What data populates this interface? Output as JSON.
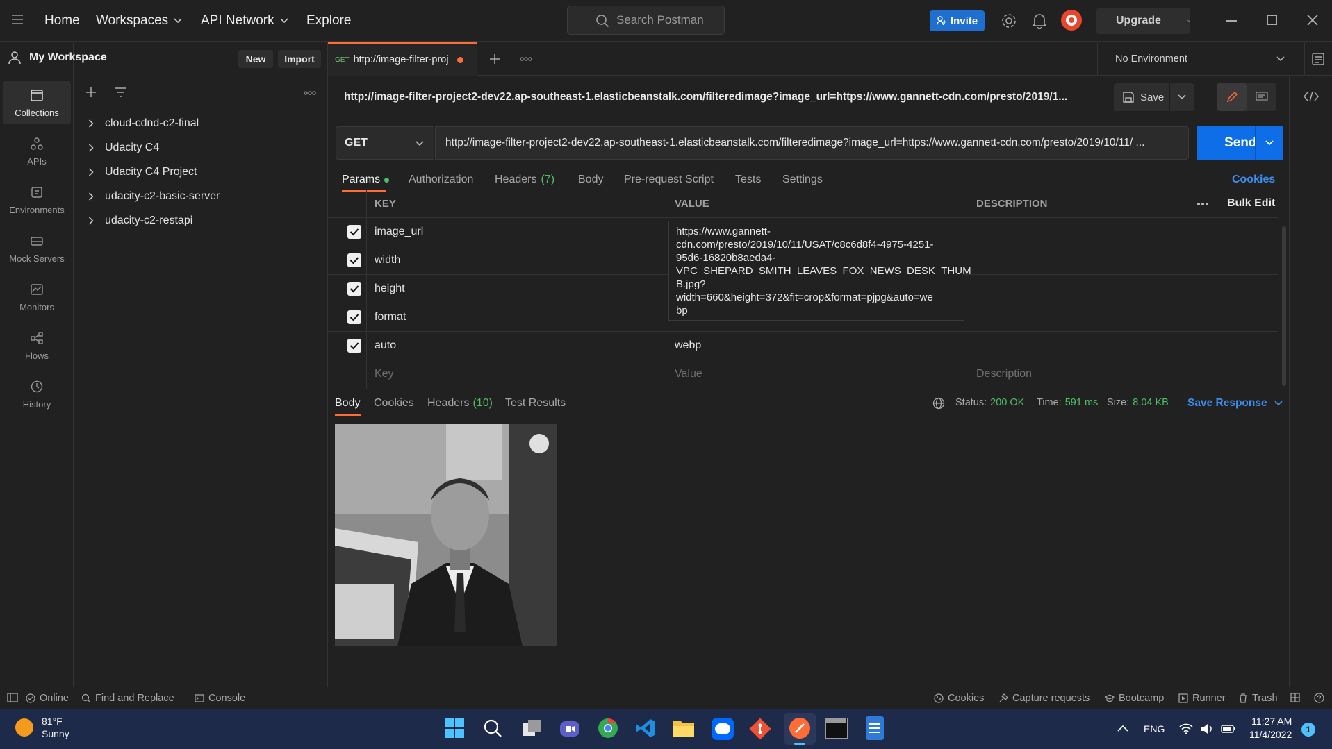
{
  "topbar": {
    "nav": [
      "Home",
      "Workspaces",
      "API Network",
      "Explore"
    ],
    "search_placeholder": "Search Postman",
    "invite_label": "Invite",
    "upgrade_label": "Upgrade"
  },
  "workspace": {
    "name": "My Workspace",
    "new_label": "New",
    "import_label": "Import"
  },
  "rail": {
    "items": [
      {
        "label": "Collections",
        "icon": "collections-icon"
      },
      {
        "label": "APIs",
        "icon": "apis-icon"
      },
      {
        "label": "Environments",
        "icon": "environments-icon"
      },
      {
        "label": "Mock Servers",
        "icon": "mock-servers-icon"
      },
      {
        "label": "Monitors",
        "icon": "monitors-icon"
      },
      {
        "label": "Flows",
        "icon": "flows-icon"
      },
      {
        "label": "History",
        "icon": "history-icon"
      }
    ]
  },
  "collections": [
    "cloud-cdnd-c2-final",
    "Udacity C4",
    "Udacity C4 Project",
    "udacity-c2-basic-server",
    "udacity-c2-restapi"
  ],
  "tab": {
    "method": "GET",
    "title": "http://image-filter-proj"
  },
  "environment": "No Environment",
  "request": {
    "heading": "http://image-filter-project2-dev22.ap-southeast-1.elasticbeanstalk.com/filteredimage?image_url=https://www.gannett-cdn.com/presto/2019/1...",
    "save_label": "Save",
    "method": "GET",
    "url": "http://image-filter-project2-dev22.ap-southeast-1.elasticbeanstalk.com/filteredimage?image_url=https://www.gannett-cdn.com/presto/2019/10/11/ ...",
    "send_label": "Send"
  },
  "request_tabs": {
    "params": "Params",
    "authorization": "Authorization",
    "headers": "Headers",
    "headers_count": "(7)",
    "body": "Body",
    "prerequest": "Pre-request Script",
    "tests": "Tests",
    "settings": "Settings",
    "cookies": "Cookies"
  },
  "params_table": {
    "headers": {
      "key": "KEY",
      "value": "VALUE",
      "description": "DESCRIPTION",
      "bulk_edit": "Bulk Edit"
    },
    "rows": [
      {
        "key": "image_url",
        "value": ""
      },
      {
        "key": "width",
        "value": ""
      },
      {
        "key": "height",
        "value": ""
      },
      {
        "key": "format",
        "value": ""
      },
      {
        "key": "auto",
        "value": "webp"
      }
    ],
    "placeholder": {
      "key": "Key",
      "value": "Value",
      "description": "Description"
    },
    "tooltip": "https://www.gannett-cdn.com/presto/2019/10/11/USAT/c8c6d8f4-4975-4251-95d6-16820b8aeda4-VPC_SHEPARD_SMITH_LEAVES_FOX_NEWS_DESK_THUMB.jpg?width=660&height=372&fit=crop&format=pjpg&auto=webp",
    "tooltip_lines": [
      "https://www.gannett-",
      "cdn.com/presto/2019/10/11/USAT/c8c6d8f4-4975-4251-",
      "95d6-16820b8aeda4-",
      "VPC_SHEPARD_SMITH_LEAVES_FOX_NEWS_DESK_THUM",
      "B.jpg?",
      "width=660&height=372&fit=crop&format=pjpg&auto=we",
      "bp"
    ]
  },
  "response": {
    "tabs": {
      "body": "Body",
      "cookies": "Cookies",
      "headers": "Headers",
      "headers_count": "(10)",
      "test_results": "Test Results"
    },
    "status_label": "Status:",
    "status_value": "200 OK",
    "time_label": "Time:",
    "time_value": "591 ms",
    "size_label": "Size:",
    "size_value": "8.04 KB",
    "save_response": "Save Response"
  },
  "statusbar": {
    "online": "Online",
    "find_replace": "Find and Replace",
    "console": "Console",
    "cookies": "Cookies",
    "capture": "Capture requests",
    "bootcamp": "Bootcamp",
    "runner": "Runner",
    "trash": "Trash"
  },
  "taskbar": {
    "weather_temp": "81°F",
    "weather_desc": "Sunny",
    "lang": "ENG",
    "time": "11:27 AM",
    "date": "11/4/2022",
    "notification_count": "1"
  },
  "colors": {
    "accent": "#ff6c37",
    "link": "#3d8ef0",
    "success": "#4fbf67",
    "send": "#0d6ee8"
  }
}
